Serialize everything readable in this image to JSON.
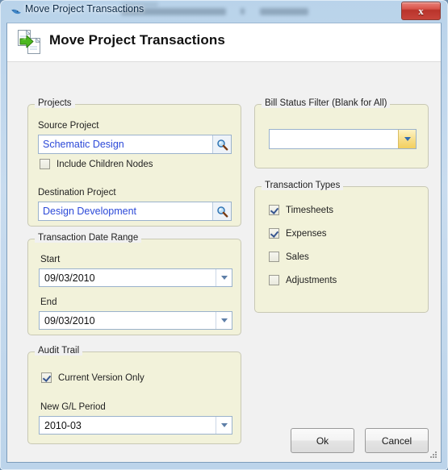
{
  "window": {
    "title": "Move Project Transactions",
    "title_icon": "bird-icon",
    "close_label": "x"
  },
  "header": {
    "title": "Move Project Transactions",
    "icon": "move-documents-icon"
  },
  "projects": {
    "legend": "Projects",
    "source_label": "Source Project",
    "source_value": "Schematic Design",
    "source_lookup_icon": "magnifier-icon",
    "include_children": {
      "label": "Include Children Nodes",
      "checked": false
    },
    "destination_label": "Destination Project",
    "destination_value": "Design Development",
    "destination_lookup_icon": "magnifier-icon"
  },
  "date_range": {
    "legend": "Transaction Date Range",
    "start_label": "Start",
    "start_value": "09/03/2010",
    "end_label": "End",
    "end_value": "09/03/2010",
    "dropdown_icon": "chevron-down-icon"
  },
  "audit_trail": {
    "legend": "Audit Trail",
    "current_version_only": {
      "label": "Current Version Only",
      "checked": true
    },
    "gl_period_label": "New G/L Period",
    "gl_period_value": "2010-03",
    "dropdown_icon": "chevron-down-icon"
  },
  "bill_status": {
    "legend": "Bill Status Filter (Blank for All)",
    "value": "",
    "placeholder": "",
    "dropdown_icon": "chevron-down-icon"
  },
  "transaction_types": {
    "legend": "Transaction Types",
    "items": [
      {
        "label": "Timesheets",
        "checked": true
      },
      {
        "label": "Expenses",
        "checked": true
      },
      {
        "label": "Sales",
        "checked": false
      },
      {
        "label": "Adjustments",
        "checked": false
      }
    ]
  },
  "footer": {
    "ok_label": "Ok",
    "cancel_label": "Cancel"
  },
  "colors": {
    "group_background": "#f2f2da",
    "group_border": "#c8c8b4",
    "client_background": "#f1f1f1",
    "link_text": "#2c49d8",
    "frame_glass": "#bcd4ea",
    "close_red": "#c7443a",
    "amber_button": "#f2cf5e"
  }
}
